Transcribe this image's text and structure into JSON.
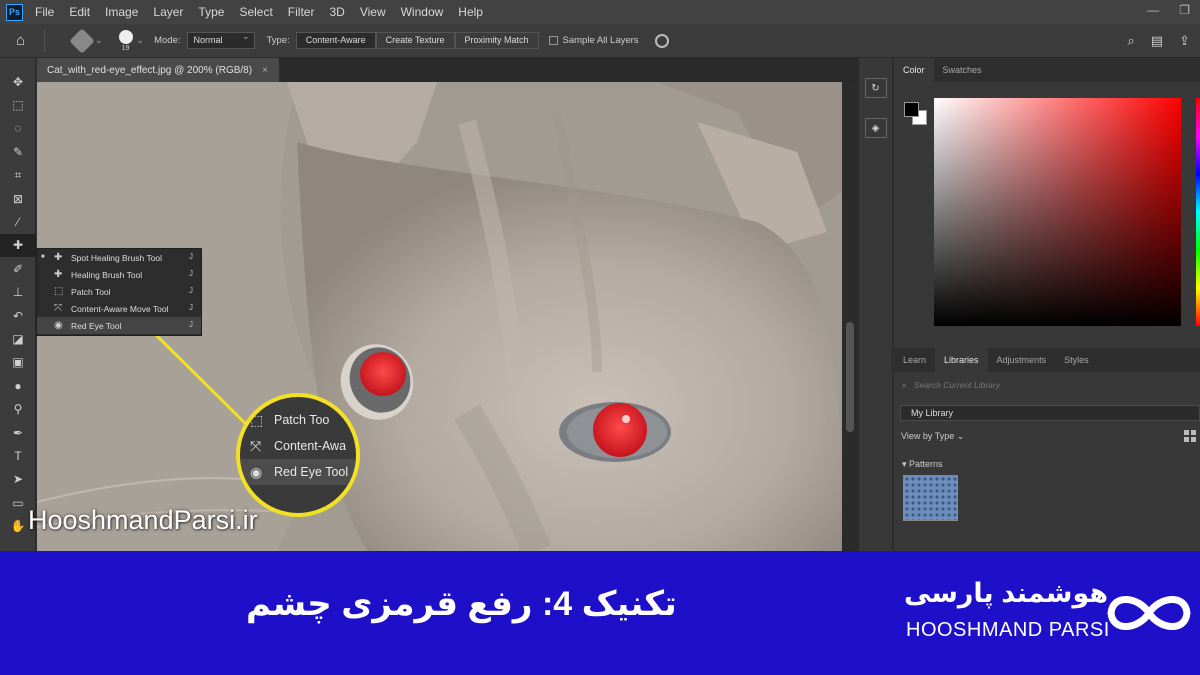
{
  "menubar": {
    "logo": "Ps",
    "items": [
      "File",
      "Edit",
      "Image",
      "Layer",
      "Type",
      "Select",
      "Filter",
      "3D",
      "View",
      "Window",
      "Help"
    ]
  },
  "options": {
    "brush_size": "19",
    "mode_label": "Mode:",
    "mode_value": "Normal",
    "type_label": "Type:",
    "type_buttons": [
      "Content-Aware",
      "Create Texture",
      "Proximity Match"
    ],
    "sample_all_layers": "Sample All Layers"
  },
  "document": {
    "tab_title": "Cat_with_red-eye_effect.jpg @ 200% (RGB/8)",
    "close": "×"
  },
  "flyout": {
    "items": [
      {
        "label": "Spot Healing Brush Tool",
        "key": "J"
      },
      {
        "label": "Healing Brush Tool",
        "key": "J"
      },
      {
        "label": "Patch Tool",
        "key": "J"
      },
      {
        "label": "Content-Aware Move Tool",
        "key": "J"
      },
      {
        "label": "Red Eye Tool",
        "key": "J"
      }
    ]
  },
  "callout": {
    "items": [
      "Patch Too",
      "Content-Awa",
      "Red Eye Tool"
    ]
  },
  "panels": {
    "color_tabs": [
      "Color",
      "Swatches"
    ],
    "lib_tabs": [
      "Learn",
      "Libraries",
      "Adjustments",
      "Styles"
    ],
    "search_placeholder": "Search Current Library",
    "library": "My Library",
    "view_by": "View by Type",
    "patterns": "Patterns"
  },
  "watermark": "HooshmandParsi.ir",
  "banner": {
    "title": "تکنیک 4: رفع قرمزی چشم",
    "brand_fa": "هوشمند پارسی",
    "brand_en": "HOOSHMAND PARSI"
  },
  "colors": {
    "banner": "#1e0fc9",
    "highlight": "#f2e025",
    "eye": "#e0202a"
  }
}
